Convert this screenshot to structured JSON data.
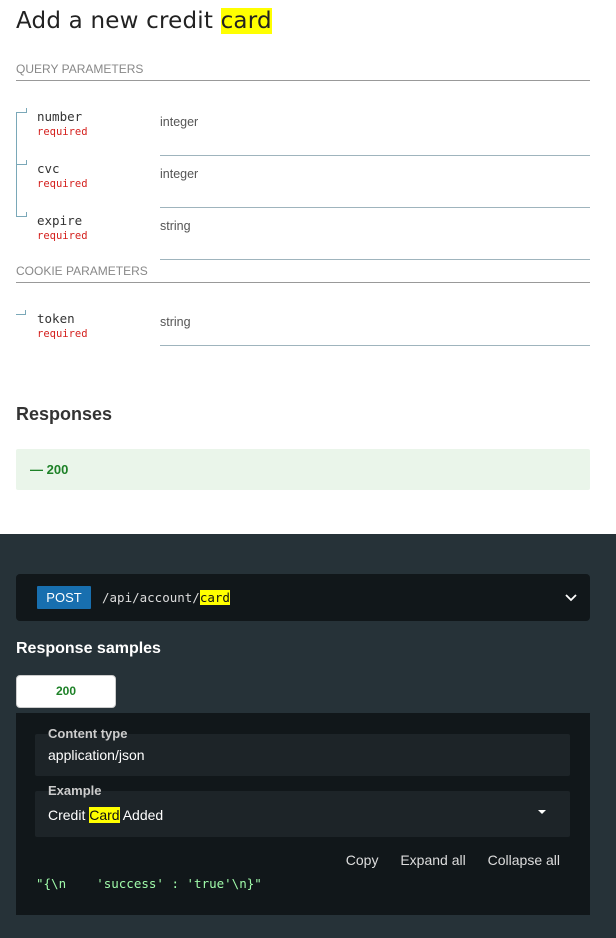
{
  "page": {
    "title_prefix": "Add a new credit ",
    "title_highlight": "card"
  },
  "query_params": {
    "header": "QUERY PARAMETERS",
    "items": [
      {
        "name": "number",
        "required": "required",
        "type": "integer"
      },
      {
        "name": "cvc",
        "required": "required",
        "type": "integer"
      },
      {
        "name": "expire",
        "required": "required",
        "type": "string"
      }
    ]
  },
  "cookie_params": {
    "header": "COOKIE PARAMETERS",
    "items": [
      {
        "name": "token",
        "required": "required",
        "type": "string"
      }
    ]
  },
  "responses": {
    "title": "Responses",
    "items": [
      {
        "label": "— 200"
      }
    ]
  },
  "endpoint": {
    "method": "POST",
    "path_prefix": "/api/account/",
    "path_highlight": "card"
  },
  "samples": {
    "title": "Response samples",
    "tab": "200",
    "content_type_label": "Content type",
    "content_type_value": "application/json",
    "example_label": "Example",
    "example_prefix": "Credit ",
    "example_highlight": "Card",
    "example_suffix": " Added",
    "copy": "Copy",
    "expand_all": "Expand all",
    "collapse_all": "Collapse all",
    "code": "\"{\\n    'success' : 'true'\\n}\""
  },
  "colors": {
    "highlight": "#ffff00",
    "required": "#d41f1c",
    "success_green": "#1d8127",
    "dark_bg": "#263238",
    "post_blue": "#186faf"
  }
}
